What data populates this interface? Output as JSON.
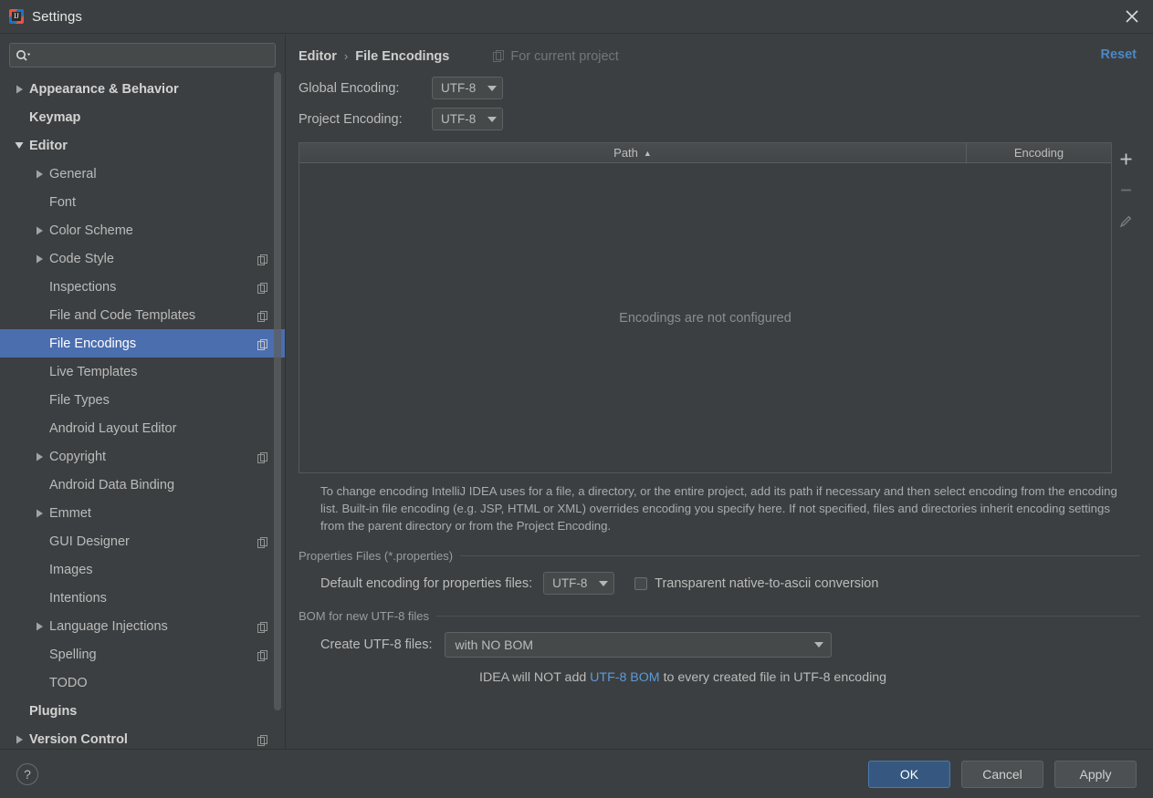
{
  "window": {
    "title": "Settings",
    "app_icon": "intellij-idea-icon",
    "close_icon": "close-icon"
  },
  "sidebar": {
    "search": {
      "placeholder": "",
      "value": "",
      "icon": "search-icon"
    },
    "items": [
      {
        "label": "Appearance & Behavior",
        "indent": 0,
        "arrow": "right",
        "bold": true,
        "badge": false,
        "selected": false
      },
      {
        "label": "Keymap",
        "indent": 0,
        "arrow": "none",
        "bold": true,
        "badge": false,
        "selected": false
      },
      {
        "label": "Editor",
        "indent": 0,
        "arrow": "down",
        "bold": true,
        "badge": false,
        "selected": false
      },
      {
        "label": "General",
        "indent": 1,
        "arrow": "right",
        "bold": false,
        "badge": false,
        "selected": false
      },
      {
        "label": "Font",
        "indent": 1,
        "arrow": "none",
        "bold": false,
        "badge": false,
        "selected": false
      },
      {
        "label": "Color Scheme",
        "indent": 1,
        "arrow": "right",
        "bold": false,
        "badge": false,
        "selected": false
      },
      {
        "label": "Code Style",
        "indent": 1,
        "arrow": "right",
        "bold": false,
        "badge": true,
        "selected": false
      },
      {
        "label": "Inspections",
        "indent": 1,
        "arrow": "none",
        "bold": false,
        "badge": true,
        "selected": false
      },
      {
        "label": "File and Code Templates",
        "indent": 1,
        "arrow": "none",
        "bold": false,
        "badge": true,
        "selected": false
      },
      {
        "label": "File Encodings",
        "indent": 1,
        "arrow": "none",
        "bold": false,
        "badge": true,
        "selected": true
      },
      {
        "label": "Live Templates",
        "indent": 1,
        "arrow": "none",
        "bold": false,
        "badge": false,
        "selected": false
      },
      {
        "label": "File Types",
        "indent": 1,
        "arrow": "none",
        "bold": false,
        "badge": false,
        "selected": false
      },
      {
        "label": "Android Layout Editor",
        "indent": 1,
        "arrow": "none",
        "bold": false,
        "badge": false,
        "selected": false
      },
      {
        "label": "Copyright",
        "indent": 1,
        "arrow": "right",
        "bold": false,
        "badge": true,
        "selected": false
      },
      {
        "label": "Android Data Binding",
        "indent": 1,
        "arrow": "none",
        "bold": false,
        "badge": false,
        "selected": false
      },
      {
        "label": "Emmet",
        "indent": 1,
        "arrow": "right",
        "bold": false,
        "badge": false,
        "selected": false
      },
      {
        "label": "GUI Designer",
        "indent": 1,
        "arrow": "none",
        "bold": false,
        "badge": true,
        "selected": false
      },
      {
        "label": "Images",
        "indent": 1,
        "arrow": "none",
        "bold": false,
        "badge": false,
        "selected": false
      },
      {
        "label": "Intentions",
        "indent": 1,
        "arrow": "none",
        "bold": false,
        "badge": false,
        "selected": false
      },
      {
        "label": "Language Injections",
        "indent": 1,
        "arrow": "right",
        "bold": false,
        "badge": true,
        "selected": false
      },
      {
        "label": "Spelling",
        "indent": 1,
        "arrow": "none",
        "bold": false,
        "badge": true,
        "selected": false
      },
      {
        "label": "TODO",
        "indent": 1,
        "arrow": "none",
        "bold": false,
        "badge": false,
        "selected": false
      },
      {
        "label": "Plugins",
        "indent": 0,
        "arrow": "none",
        "bold": true,
        "badge": false,
        "selected": false
      },
      {
        "label": "Version Control",
        "indent": 0,
        "arrow": "right",
        "bold": true,
        "badge": true,
        "selected": false
      }
    ]
  },
  "main": {
    "breadcrumb": {
      "parent": "Editor",
      "separator": "›",
      "current": "File Encodings"
    },
    "for_current_project": {
      "label": "For current project",
      "icon": "project-scope-icon"
    },
    "reset_label": "Reset",
    "global_encoding": {
      "label": "Global Encoding:",
      "value": "UTF-8"
    },
    "project_encoding": {
      "label": "Project Encoding:",
      "value": "UTF-8"
    },
    "table": {
      "columns": [
        "Path",
        "Encoding"
      ],
      "sort_column": "Path",
      "sort_direction": "▲",
      "rows": [],
      "empty_text": "Encodings are not configured",
      "buttons": [
        {
          "name": "add-button",
          "glyph": "plus-icon",
          "enabled": true
        },
        {
          "name": "remove-button",
          "glyph": "minus-icon",
          "enabled": false
        },
        {
          "name": "edit-button",
          "glyph": "pencil-icon",
          "enabled": false
        }
      ]
    },
    "description": "To change encoding IntelliJ IDEA uses for a file, a directory, or the entire project, add its path if necessary and then select encoding from the encoding list. Built-in file encoding (e.g. JSP, HTML or XML) overrides encoding you specify here. If not specified, files and directories inherit encoding settings from the parent directory or from the Project Encoding.",
    "properties_section": {
      "title": "Properties Files (*.properties)",
      "default_encoding_label": "Default encoding for properties files:",
      "default_encoding_value": "UTF-8",
      "transparent_label": "Transparent native-to-ascii conversion",
      "transparent_checked": false
    },
    "bom_section": {
      "title": "BOM for new UTF-8 files",
      "create_label": "Create UTF-8 files:",
      "create_value": "with NO BOM",
      "note_prefix": "IDEA will NOT add ",
      "note_link": "UTF-8 BOM",
      "note_suffix": " to every created file in UTF-8 encoding"
    }
  },
  "footer": {
    "help_glyph": "?",
    "ok_label": "OK",
    "cancel_label": "Cancel",
    "apply_label": "Apply"
  },
  "colors": {
    "window_bg": "#3c3f41",
    "selection_blue": "#4b6eaf",
    "primary_button": "#365880",
    "link_blue": "#5c9bd6",
    "reset_link": "#4a88c7",
    "text": "#bbbbbb"
  }
}
